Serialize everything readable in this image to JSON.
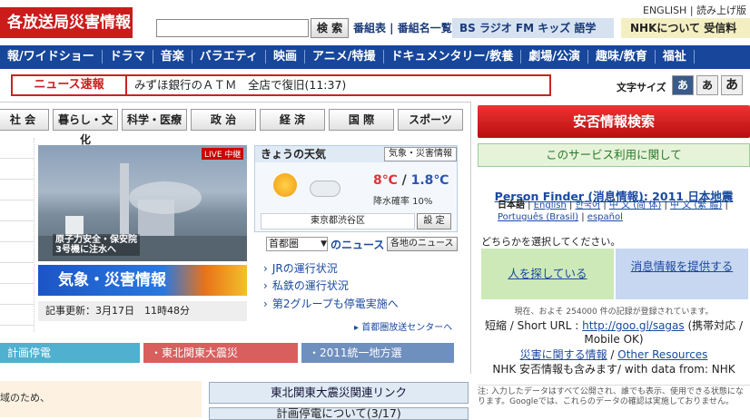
{
  "header": {
    "logo": "各放送局災害情報",
    "search_button": "検 索",
    "top_links": "番組表 | 番組名一覧",
    "bs_nav": "BS  ラジオ  FM  キッズ  語学",
    "nhk_about": "NHKについて  受信料",
    "lang_links": "ENGLISH | 読み上げ版"
  },
  "global_nav": [
    "報/ワイドショー",
    "ドラマ",
    "音楽",
    "バラエティ",
    "映画",
    "アニメ/特撮",
    "ドキュメンタリー/教養",
    "劇場/公演",
    "趣味/教育",
    "福祉"
  ],
  "news_flash": {
    "label": "ニュース速報",
    "text": "みずほ銀行のＡＴＭ　全店で復旧(11:37)"
  },
  "font_size": {
    "label": "文字サイズ",
    "sizes": [
      "あ",
      "あ",
      "あ"
    ]
  },
  "categories": [
    "社 会",
    "暮らし・文化",
    "科学・医療",
    "政 治",
    "経 済",
    "国 際",
    "スポーツ"
  ],
  "photo": {
    "live_tag": "LIVE 中継",
    "caption_line1": "原子力安全・保安院",
    "caption_line2": "3号機に注水へ"
  },
  "disaster_banner": "気象・災害情報",
  "update": "記事更新：3月17日　11時48分",
  "weather": {
    "title": "きょうの天気",
    "button": "気象・災害情報",
    "high": "8℃",
    "low": "1.8℃",
    "rain": "降水確率  10%",
    "place": "東京都渋谷区",
    "set_button": "設 定"
  },
  "regional": {
    "select": "首都圏",
    "suffix": "のニュース",
    "button": "各地のニュース",
    "items": [
      "JRの運行状況",
      "私鉄の運行状況",
      "第2グループも停電実施へ"
    ],
    "center_link": "首都圏放送センターへ"
  },
  "bottom_tabs": [
    "計画停電",
    "東北関東大震災",
    "2011統一地方選"
  ],
  "bottom_left_text": "域のため、",
  "related": {
    "link1": "東北関東大震災関連リンク",
    "link2": "計画停電について(3/17)"
  },
  "anpi": {
    "search_button": "安否情報検索",
    "service": "このサービス利用に関して",
    "title": "Person Finder (消息情報): 2011 日本地震",
    "lang_current": "日本語",
    "langs": [
      "English",
      "한국어",
      "中 文 (简 体)",
      "中 文 (繁 體)",
      "Português (Brasil)",
      "español"
    ],
    "choose": "どちらかを選択してください。",
    "seek": "人を探している",
    "provide": "消息情報を提供する",
    "count": "現在、およそ 254000 件の記録が登録されています。",
    "short_label": "短縮 / Short URL :",
    "short_url": "http://goo.gl/sagas",
    "short_suffix": "(携帯対応 / Mobile OK)",
    "other_res_jp": "災害に関する情報",
    "other_res_en": "Other Resources",
    "with_data": "NHK 安否情報も含みます/ with data from: NHK",
    "note": "注: 入力したデータはすべて公開され、誰でも表示、使用できる状態になります。Googleでは、これらのデータの確認は実施しておりません。"
  },
  "colors": {
    "brand_red": "#cc1b1b",
    "nav_blue": "#17469a",
    "link_blue": "#1a4aa0"
  }
}
